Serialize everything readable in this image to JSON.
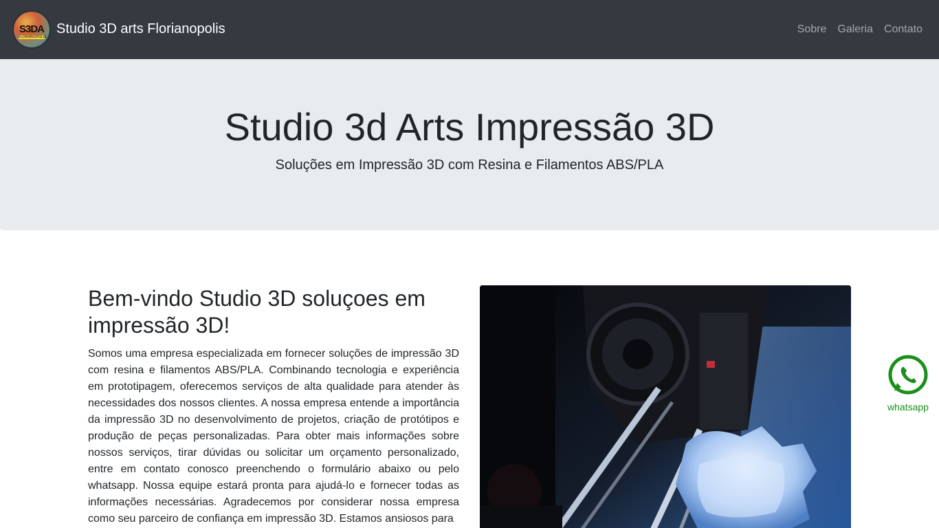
{
  "navbar": {
    "logo_text": "S3DA",
    "logo_subtext": "FLORIANOPOLIS",
    "brand_title": "Studio 3D arts Florianopolis",
    "links": [
      {
        "label": "Sobre"
      },
      {
        "label": "Galeria"
      },
      {
        "label": "Contato"
      }
    ]
  },
  "hero": {
    "title": "Studio 3d Arts Impressão 3D",
    "subtitle": "Soluções em Impressão 3D com Resina e Filamentos ABS/PLA"
  },
  "intro": {
    "heading": "Bem-vindo Studio 3D soluçoes em impressão 3D!",
    "body": "Somos uma empresa especializada em fornecer soluções de impressão 3D com resina e filamentos ABS/PLA. Combinando tecnologia e experiência em prototipagem, oferecemos serviços de alta qualidade para atender às necessidades dos nossos clientes. A nossa empresa entende a importância da impressão 3D no desenvolvimento de projetos, criação de protótipos e produção de peças personalizadas. Para obter mais informações sobre nossos serviços, tirar dúvidas ou solicitar um orçamento personalizado, entre em contato conosco preenchendo o formulário abaixo ou pelo whatsapp. Nossa equipe estará pronta para ajudá-lo e fornecer todas as informações necessárias. Agradecemos por considerar nossa empresa como seu parceiro de confiança em impressão 3D. Estamos ansiosos para"
  },
  "photo": {
    "icon": "3d-printer-photo"
  },
  "whatsapp": {
    "label": "whatsapp",
    "icon": "whatsapp-icon",
    "color": "#1a8f1a"
  },
  "colors": {
    "navbar_bg": "#343a40",
    "hero_bg": "#e9ecef"
  }
}
